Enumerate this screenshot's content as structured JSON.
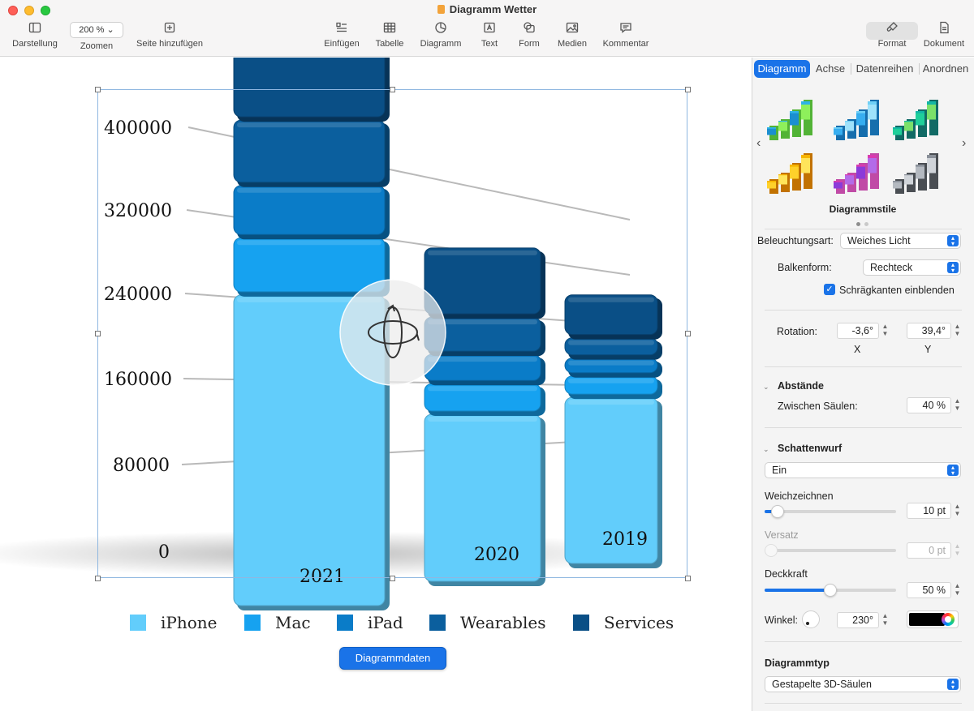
{
  "window": {
    "title": "Diagramm Wetter"
  },
  "toolbar": {
    "view": "Darstellung",
    "zoom_value": "200 %",
    "zoom": "Zoomen",
    "add_page": "Seite hinzufügen",
    "insert": "Einfügen",
    "table": "Tabelle",
    "chart": "Diagramm",
    "text": "Text",
    "shape": "Form",
    "media": "Medien",
    "comment": "Kommentar",
    "format": "Format",
    "document": "Dokument"
  },
  "chart_data": {
    "type": "bar",
    "stacked": true,
    "style": "3D stacked columns",
    "categories": [
      "2021",
      "2020",
      "2019"
    ],
    "y_ticks": [
      "400000",
      "320000",
      "240000",
      "160000",
      "80000",
      "0"
    ],
    "ylim": [
      0,
      400000
    ],
    "series": [
      {
        "name": "iPhone",
        "color": "#62cdfb",
        "values": [
          192000,
          128000,
          142000
        ]
      },
      {
        "name": "Mac",
        "color": "#16a2f0",
        "values": [
          35000,
          23000,
          18000
        ]
      },
      {
        "name": "iPad",
        "color": "#0a7cc8",
        "values": [
          32000,
          22000,
          15000
        ]
      },
      {
        "name": "Wearables",
        "color": "#0b5f9e",
        "values": [
          40000,
          28000,
          17000
        ]
      },
      {
        "name": "Services",
        "color": "#0a4f86",
        "values": [
          85000,
          52000,
          36000
        ]
      }
    ]
  },
  "canvas": {
    "chart_data_button": "Diagrammdaten"
  },
  "panel": {
    "tabs": [
      "Diagramm",
      "Achse",
      "Datenreihen",
      "Anordnen"
    ],
    "styles_label": "Diagrammstile",
    "style_palettes": [
      [
        "#2fb3e6",
        "#1b8fd0",
        "#67e043",
        "#8ef05b"
      ],
      [
        "#6fd0f7",
        "#37aef0",
        "#1b89d8",
        "#9fe2fb"
      ],
      [
        "#12b5a5",
        "#1fcf9a",
        "#15857e",
        "#7ae06a"
      ],
      [
        "#f7b500",
        "#ffd12a",
        "#f38f00",
        "#ffe45a"
      ],
      [
        "#d93bb0",
        "#8b3bd9",
        "#f05ccf",
        "#b36be8"
      ],
      [
        "#8a9099",
        "#b4b9c0",
        "#5c6168",
        "#d0d4d9"
      ]
    ],
    "lighting_label": "Beleuchtungsart:",
    "lighting_value": "Weiches Licht",
    "bar_shape_label": "Balkenform:",
    "bar_shape_value": "Rechteck",
    "bevel_label": "Schrägkanten einblenden",
    "rotation_label": "Rotation:",
    "rotation_x": "-3,6°",
    "rotation_y": "39,4°",
    "x_label": "X",
    "y_label": "Y",
    "spacing_heading": "Abstände",
    "between_columns_label": "Zwischen Säulen:",
    "between_columns_value": "40 %",
    "shadow_heading": "Schattenwurf",
    "shadow_value": "Ein",
    "blur_label": "Weichzeichnen",
    "blur_value": "10 pt",
    "blur_level": 0.1,
    "offset_label": "Versatz",
    "offset_value": "0 pt",
    "offset_level": 0,
    "opacity_label": "Deckkraft",
    "opacity_value": "50 %",
    "opacity_level": 0.5,
    "angle_label": "Winkel:",
    "angle_value": "230°",
    "shadow_color": "#000000",
    "chart_type_heading": "Diagrammtyp",
    "chart_type_value": "Gestapelte 3D-Säulen"
  }
}
